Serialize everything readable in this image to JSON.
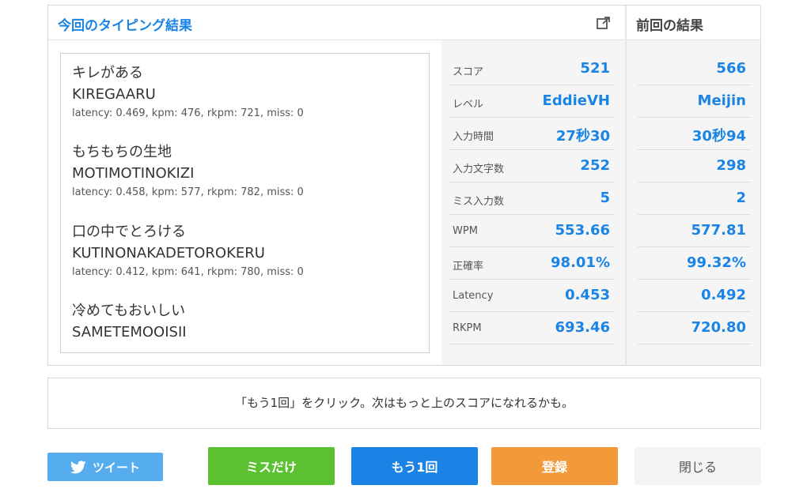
{
  "result_panel": {
    "title": "今回のタイピング結果",
    "previous_title": "前回の結果"
  },
  "words": [
    {
      "jp": "キレがある",
      "romaji": "KIREGAARU",
      "stats": "latency: 0.469, kpm: 476, rkpm: 721, miss: 0"
    },
    {
      "jp": "もちもちの生地",
      "romaji": "MOTIMOTINOKIZI",
      "stats": "latency: 0.458, kpm: 577, rkpm: 782, miss: 0"
    },
    {
      "jp": "口の中でとろける",
      "romaji": "KUTINONAKADETOROKERU",
      "stats": "latency: 0.412, kpm: 641, rkpm: 780, miss: 0"
    },
    {
      "jp": "冷めてもおいしい",
      "romaji": "SAMETEMOOISII",
      "stats": ""
    }
  ],
  "stats": [
    {
      "label": "スコア",
      "current": "521",
      "previous": "566"
    },
    {
      "label": "レベル",
      "current": "EddieVH",
      "previous": "Meijin"
    },
    {
      "label": "入力時間",
      "current": "27秒30",
      "previous": "30秒94"
    },
    {
      "label": "入力文字数",
      "current": "252",
      "previous": "298"
    },
    {
      "label": "ミス入力数",
      "current": "5",
      "previous": "2"
    },
    {
      "label": "WPM",
      "current": "553.66",
      "previous": "577.81"
    },
    {
      "label": "正確率",
      "current": "98.01%",
      "previous": "99.32%"
    },
    {
      "label": "Latency",
      "current": "0.453",
      "previous": "0.492"
    },
    {
      "label": "RKPM",
      "current": "693.46",
      "previous": "720.80"
    }
  ],
  "message": "「もう1回」をクリック。次はもっと上のスコアになれるかも。",
  "buttons": {
    "tweet": "ツイート",
    "miss_only": "ミスだけ",
    "retry": "もう1回",
    "register": "登録",
    "close": "閉じる"
  },
  "colors": {
    "accent": "#1a84e6",
    "green": "#5cc130",
    "blue": "#1b82e6",
    "orange": "#f29a3a",
    "twitter": "#55acee"
  },
  "icons": {
    "share": "external-link-icon",
    "tweet": "twitter-bird-icon"
  }
}
